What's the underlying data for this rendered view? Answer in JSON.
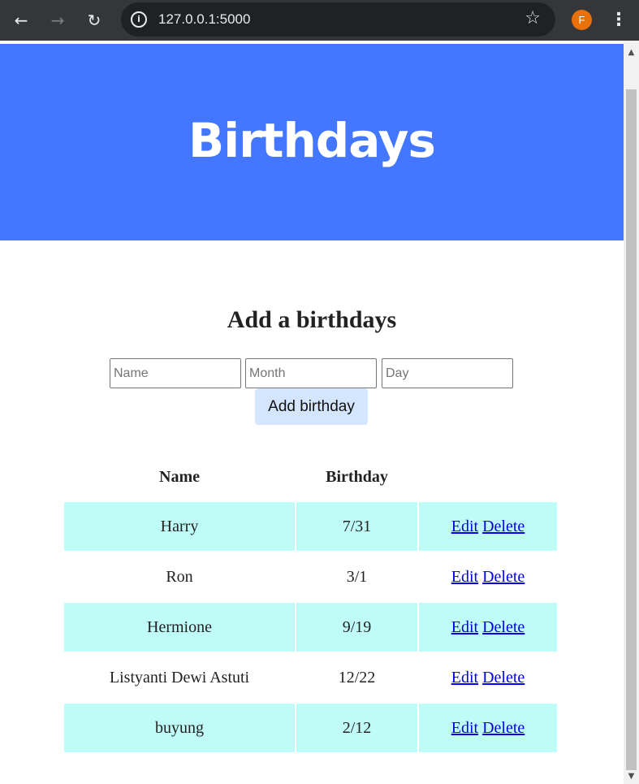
{
  "browser": {
    "url": "127.0.0.1:5000",
    "profile_initial": "F",
    "icons": {
      "back": "arrow-left",
      "forward": "arrow-right",
      "reload": "reload",
      "info": "info-circle",
      "bookmark": "star",
      "menu": "vertical-dots"
    }
  },
  "header": {
    "title": "Birthdays",
    "background": "#4477ff"
  },
  "form": {
    "title": "Add a birthdays",
    "name_placeholder": "Name",
    "month_placeholder": "Month",
    "day_placeholder": "Day",
    "submit_label": "Add birthday"
  },
  "table": {
    "columns": [
      "Name",
      "Birthday",
      ""
    ],
    "rows": [
      {
        "name": "Harry",
        "birthday": "7/31",
        "edit": "Edit",
        "delete": "Delete"
      },
      {
        "name": "Ron",
        "birthday": "3/1",
        "edit": "Edit",
        "delete": "Delete"
      },
      {
        "name": "Hermione",
        "birthday": "9/19",
        "edit": "Edit",
        "delete": "Delete"
      },
      {
        "name": "Listyanti Dewi Astuti",
        "birthday": "12/22",
        "edit": "Edit",
        "delete": "Delete"
      },
      {
        "name": "buyung",
        "birthday": "2/12",
        "edit": "Edit",
        "delete": "Delete"
      }
    ],
    "stripe_color": "#c0fcf7"
  }
}
